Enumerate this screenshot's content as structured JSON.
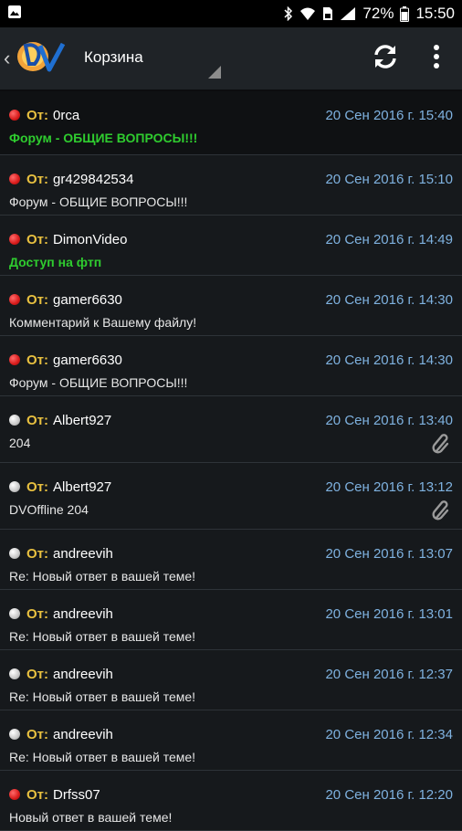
{
  "status_bar": {
    "battery": "72%",
    "time": "15:50"
  },
  "app_bar": {
    "title": "Корзина"
  },
  "from_label": "От:",
  "messages": [
    {
      "sender": "0rca",
      "datetime": "20 Сен 2016 г. 15:40",
      "subject": "Форум - ОБЩИЕ ВОПРОСЫ!!!",
      "status": "unread",
      "highlight": true,
      "attachment": false
    },
    {
      "sender": "gr429842534",
      "datetime": "20 Сен 2016 г. 15:10",
      "subject": "Форум - ОБЩИЕ ВОПРОСЫ!!!",
      "status": "unread",
      "highlight": false,
      "attachment": false
    },
    {
      "sender": "DimonVideo",
      "datetime": "20 Сен 2016 г. 14:49",
      "subject": "Доступ на фтп",
      "status": "unread",
      "highlight": true,
      "attachment": false
    },
    {
      "sender": "gamer6630",
      "datetime": "20 Сен 2016 г. 14:30",
      "subject": "Комментарий к Вашему файлу!",
      "status": "unread",
      "highlight": false,
      "attachment": false
    },
    {
      "sender": "gamer6630",
      "datetime": "20 Сен 2016 г. 14:30",
      "subject": "Форум - ОБЩИЕ ВОПРОСЫ!!!",
      "status": "unread",
      "highlight": false,
      "attachment": false
    },
    {
      "sender": "Albert927",
      "datetime": "20 Сен 2016 г. 13:40",
      "subject": "204",
      "status": "read",
      "highlight": false,
      "attachment": true
    },
    {
      "sender": "Albert927",
      "datetime": "20 Сен 2016 г. 13:12",
      "subject": "DVOffline 204",
      "status": "read",
      "highlight": false,
      "attachment": true
    },
    {
      "sender": "andreevih",
      "datetime": "20 Сен 2016 г. 13:07",
      "subject": "Re:  Новый ответ в вашей теме!",
      "status": "read",
      "highlight": false,
      "attachment": false
    },
    {
      "sender": "andreevih",
      "datetime": "20 Сен 2016 г. 13:01",
      "subject": "Re:  Новый ответ в вашей теме!",
      "status": "read",
      "highlight": false,
      "attachment": false
    },
    {
      "sender": "andreevih",
      "datetime": "20 Сен 2016 г. 12:37",
      "subject": "Re:  Новый ответ в вашей теме!",
      "status": "read",
      "highlight": false,
      "attachment": false
    },
    {
      "sender": "andreevih",
      "datetime": "20 Сен 2016 г. 12:34",
      "subject": "Re:  Новый ответ в вашей теме!",
      "status": "read",
      "highlight": false,
      "attachment": false
    },
    {
      "sender": "Drfss07",
      "datetime": "20 Сен 2016 г. 12:20",
      "subject": "Новый ответ в вашей теме!",
      "status": "unread",
      "highlight": false,
      "attachment": false
    }
  ],
  "icons": {
    "refresh": "refresh-icon",
    "overflow": "more-vert-icon",
    "attachment": "paperclip-icon",
    "unread_dot_color": "#d81b1b",
    "read_dot_color": "#c8c8c8"
  }
}
